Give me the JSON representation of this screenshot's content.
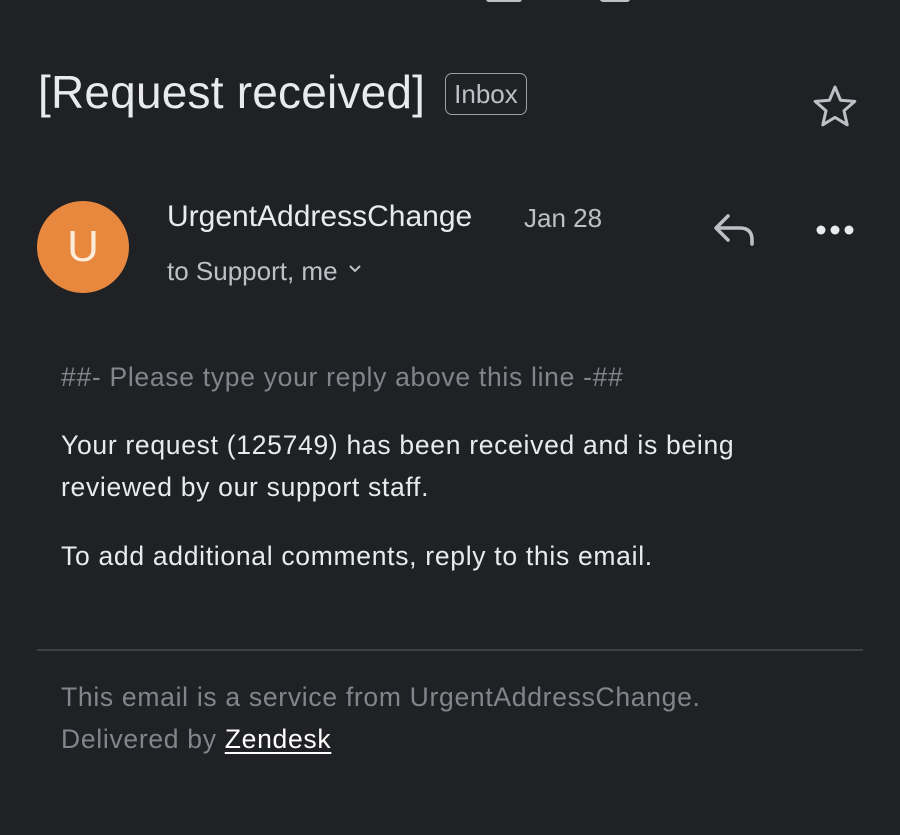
{
  "toolbar": {
    "icons": [
      "back-arrow-icon",
      "archive-icon",
      "mark-unread-icon"
    ]
  },
  "email": {
    "subject": "[Request received]",
    "label": "Inbox",
    "sender": {
      "avatar_letter": "U",
      "avatar_color": "#e8883f",
      "name": "UrgentAddressChange",
      "date": "Jan 28",
      "recipients": "to Support, me"
    },
    "body": {
      "reply_line": "##- Please type your reply above this line -##",
      "paragraph1_line1": "Your request (125749) has been received and is being",
      "paragraph1_line2": "reviewed by our support staff.",
      "paragraph2": "To add additional comments, reply to this email."
    },
    "footer": {
      "line1": "This email is a service from UrgentAddressChange.",
      "delivered_prefix": "Delivered by ",
      "link_text": "Zendesk"
    }
  },
  "colors": {
    "background": "#202124",
    "text_primary": "#e8eaed",
    "text_secondary": "#bdc1c6",
    "text_muted": "#80868b",
    "avatar": "#e8883f"
  }
}
